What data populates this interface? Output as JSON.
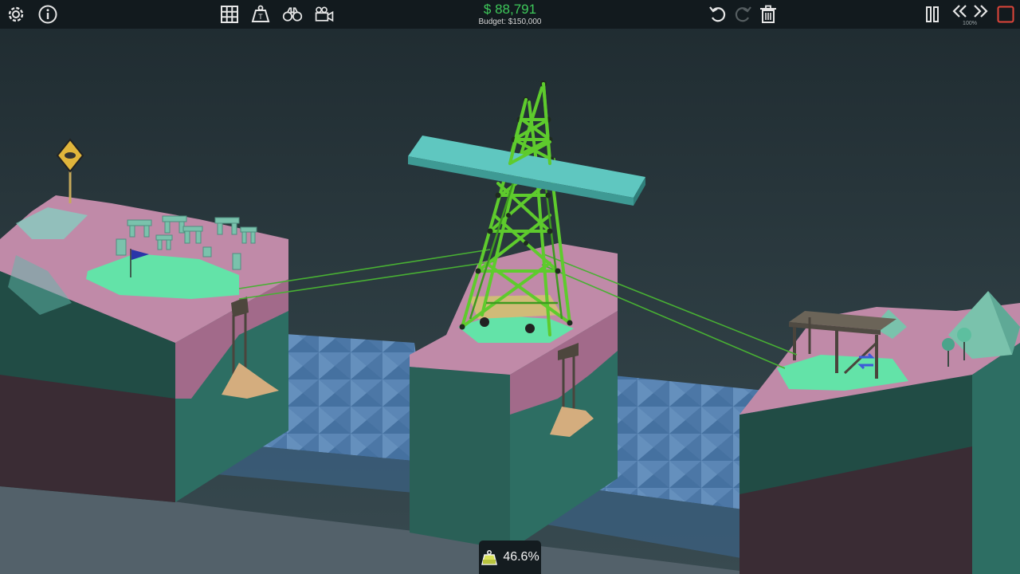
{
  "toolbar": {
    "left_icons": [
      "gear-icon",
      "info-icon"
    ],
    "center_icons": [
      "grid-icon",
      "weight-icon",
      "binoculars-icon",
      "camera-icon"
    ],
    "right_icons": [
      "undo-icon",
      "redo-icon",
      "trash-icon"
    ],
    "far_right_icons": [
      "pause-icon",
      "rewind-icon",
      "fast-forward-icon",
      "stop-icon"
    ]
  },
  "budget": {
    "spent": "$ 88,791",
    "limit": "Budget: $150,000"
  },
  "simulation": {
    "speed": "100%"
  },
  "stress_meter": {
    "value": "46.6%",
    "icon": "weight-icon"
  },
  "colors": {
    "money": "#3ec85a",
    "structure": "#5ecb2d",
    "grass": "#63e3a8",
    "water": "#4f7aa8",
    "rock": "#c48aa8",
    "stop": "#e0453a"
  }
}
